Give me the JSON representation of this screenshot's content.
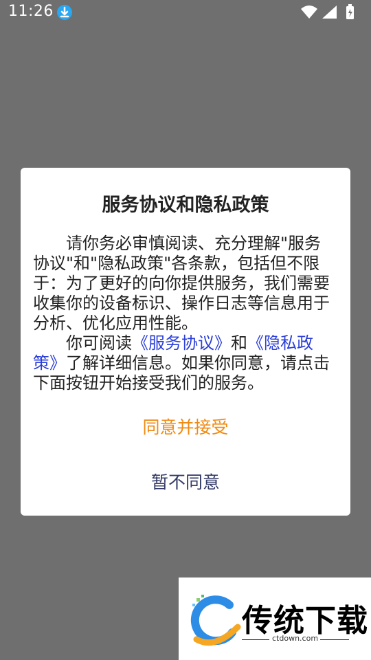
{
  "status_bar": {
    "time": "11:26"
  },
  "dialog": {
    "title": "服务协议和隐私政策",
    "paragraph1": "请你务必审慎阅读、充分理解\"服务协议\"和\"隐私政策\"各条款，包括但不限于：为了更好的向你提供服务，我们需要收集你的设备标识、操作日志等信息用于分析、优化应用性能。",
    "paragraph2_prefix": "你可阅读",
    "service_link": "《服务协议》",
    "and_text": "和",
    "privacy_link": "《隐私政策》",
    "paragraph2_suffix": "了解详细信息。如果你同意，请点击下面按钮开始接受我们的服务。",
    "agree_label": "同意并接受",
    "disagree_label": "暂不同意"
  },
  "watermark": {
    "brand": "传统下载",
    "domain": "ctdown.com"
  },
  "colors": {
    "overlay": "#6f6f6f",
    "agree": "#f08a12",
    "link": "#2b3fd8",
    "disagree": "#333a66"
  },
  "icons": [
    "download-icon",
    "wifi-icon",
    "signal-icon",
    "battery-icon"
  ]
}
